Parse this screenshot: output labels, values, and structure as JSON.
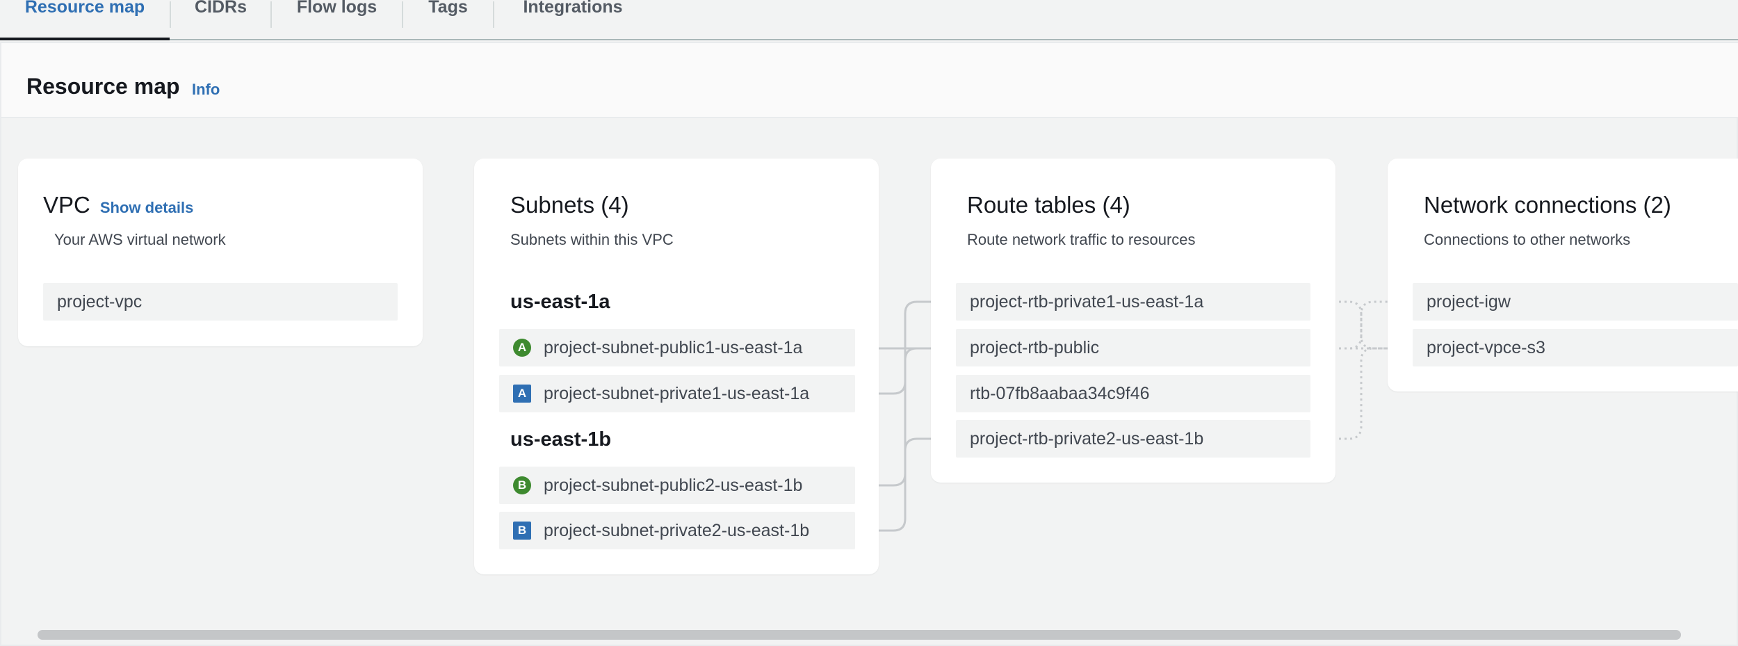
{
  "tabs": [
    {
      "label": "Resource map",
      "active": true
    },
    {
      "label": "CIDRs",
      "active": false
    },
    {
      "label": "Flow logs",
      "active": false
    },
    {
      "label": "Tags",
      "active": false
    },
    {
      "label": "Integrations",
      "active": false
    }
  ],
  "container": {
    "title": "Resource map",
    "info": "Info"
  },
  "vpc": {
    "title": "VPC",
    "show_details": "Show details",
    "subtitle": "Your AWS virtual network",
    "name": "project-vpc"
  },
  "subnets": {
    "title": "Subnets (4)",
    "subtitle": "Subnets within this VPC",
    "zones": [
      {
        "name": "us-east-1a",
        "items": [
          {
            "badge": "A",
            "type": "public",
            "label": "project-subnet-public1-us-east-1a"
          },
          {
            "badge": "A",
            "type": "private",
            "label": "project-subnet-private1-us-east-1a"
          }
        ]
      },
      {
        "name": "us-east-1b",
        "items": [
          {
            "badge": "B",
            "type": "public",
            "label": "project-subnet-public2-us-east-1b"
          },
          {
            "badge": "B",
            "type": "private",
            "label": "project-subnet-private2-us-east-1b"
          }
        ]
      }
    ]
  },
  "route_tables": {
    "title": "Route tables (4)",
    "subtitle": "Route network traffic to resources",
    "items": [
      "project-rtb-private1-us-east-1a",
      "project-rtb-public",
      "rtb-07fb8aabaa34c9f46",
      "project-rtb-private2-us-east-1b"
    ]
  },
  "network_connections": {
    "title": "Network connections (2)",
    "subtitle": "Connections to other networks",
    "items": [
      "project-igw",
      "project-vpce-s3"
    ]
  },
  "colors": {
    "accent": "#2f6fb3",
    "public_badge": "#3e8a2f",
    "private_badge": "#2f6fb3",
    "connector": "#c6c9cc"
  }
}
